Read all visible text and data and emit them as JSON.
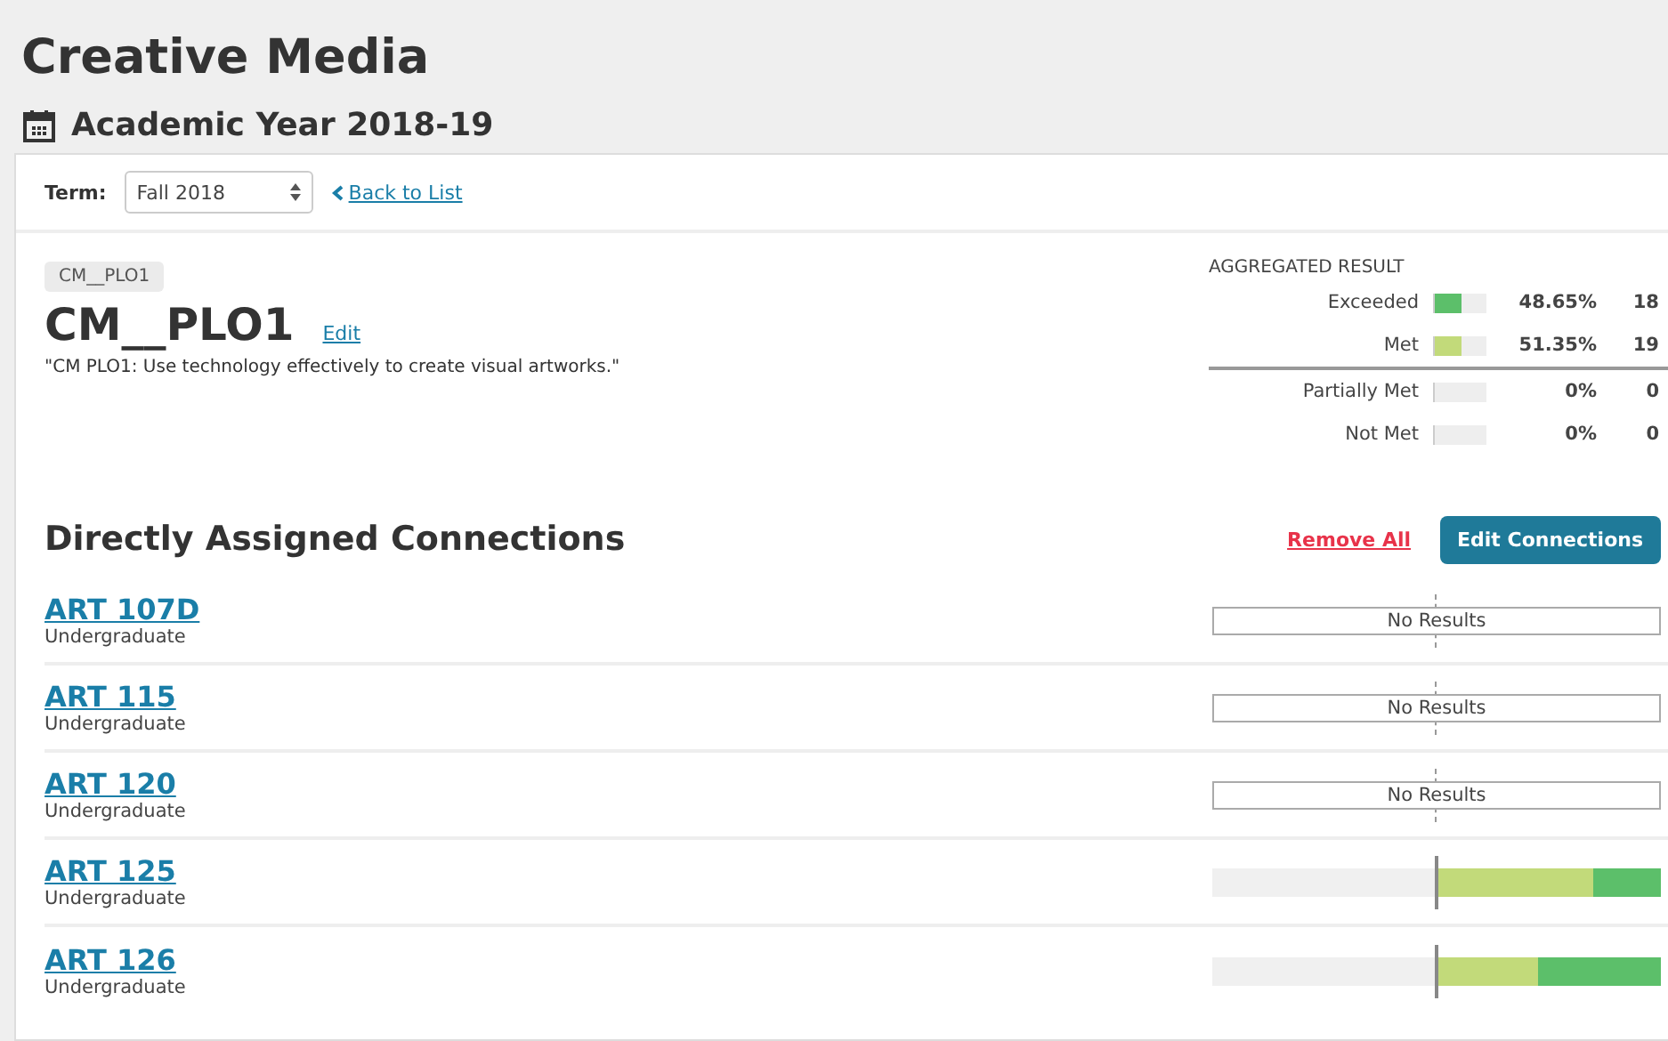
{
  "page": {
    "title": "Creative Media",
    "subtitle": "Academic Year 2018-19"
  },
  "toolbar": {
    "term_label": "Term:",
    "term_value": "Fall 2018",
    "back_link": "Back to List"
  },
  "outcome": {
    "tag": "CM__PLO1",
    "title": "CM__PLO1",
    "edit_link": "Edit",
    "description": "\"CM PLO1: Use technology effectively to create visual artworks.\""
  },
  "aggregated": {
    "heading": "AGGREGATED RESULT",
    "rows": [
      {
        "label": "Exceeded",
        "level": 0.4865,
        "color": "#5cbf6a",
        "percent": "48.65%",
        "count": "18",
        "divider_above": false
      },
      {
        "label": "Met",
        "level": 0.5135,
        "color": "#c2da7a",
        "percent": "51.35%",
        "count": "19",
        "divider_above": false
      },
      {
        "label": "Partially Met",
        "level": 0,
        "percent": "0%",
        "count": "0",
        "divider_above": true
      },
      {
        "label": "Not Met",
        "level": 0,
        "percent": "0%",
        "count": "0",
        "divider_above": false
      }
    ]
  },
  "connections": {
    "heading": "Directly Assigned Connections",
    "remove_all": "Remove All",
    "edit_button": "Edit Connections",
    "rows": [
      {
        "course": "ART 107D",
        "level_name": "Undergraduate",
        "kind": "empty",
        "result_text": "No Results"
      },
      {
        "course": "ART 115",
        "level_name": "Undergraduate",
        "kind": "empty",
        "result_text": "No Results"
      },
      {
        "course": "ART 120",
        "level_name": "Undergraduate",
        "kind": "empty",
        "result_text": "No Results"
      },
      {
        "course": "ART 125",
        "level_name": "Undergraduate",
        "kind": "bar",
        "level": 0.7
      },
      {
        "course": "ART 126",
        "level_name": "Undergraduate",
        "kind": "bar",
        "level": 0.45
      }
    ]
  }
}
